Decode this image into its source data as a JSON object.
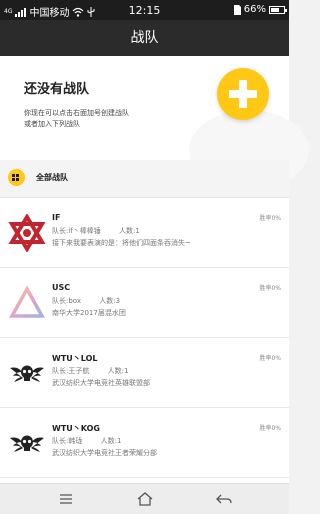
{
  "status_bar": {
    "carrier": "中国移动",
    "time": "12:15",
    "battery": "66%",
    "battery_level": 0.66,
    "network": "4G"
  },
  "title": "战队",
  "hero": {
    "title": "还没有战队",
    "desc_line1": "你现在可以点击右面加号创建战队",
    "desc_line2": "或者加入下列战队"
  },
  "section": {
    "label": "全部战队"
  },
  "teams": [
    {
      "name": "IF",
      "captain": "队长:if丶棒棒锤",
      "members": "人数:1",
      "desc": "接下来我要表演的是：将他们四面条吞消失~",
      "win_rate": "胜率0%",
      "logo": "star-of-david-icon",
      "logo_color": "#c0262f"
    },
    {
      "name": "USC",
      "captain": "队长:box",
      "members": "人数:3",
      "desc": "南华大学2017届混水团",
      "win_rate": "胜率0%",
      "logo": "triangle-icon",
      "logo_color": "#d9a0b8"
    },
    {
      "name": "WTU丶LOL",
      "captain": "队长:王子航",
      "members": "人数:1",
      "desc": "武汉纺织大学电竞社英雄联盟部",
      "win_rate": "胜率0%",
      "logo": "winged-skull-icon",
      "logo_color": "#222222"
    },
    {
      "name": "WTU丶KOG",
      "captain": "队长:韩珑",
      "members": "人数:1",
      "desc": "武汉纺织大学电竞社王者荣耀分部",
      "win_rate": "胜率0%",
      "logo": "winged-skull-icon",
      "logo_color": "#222222"
    }
  ],
  "colors": {
    "accent": "#ffc815",
    "title_bar": "#2b2b2b"
  }
}
